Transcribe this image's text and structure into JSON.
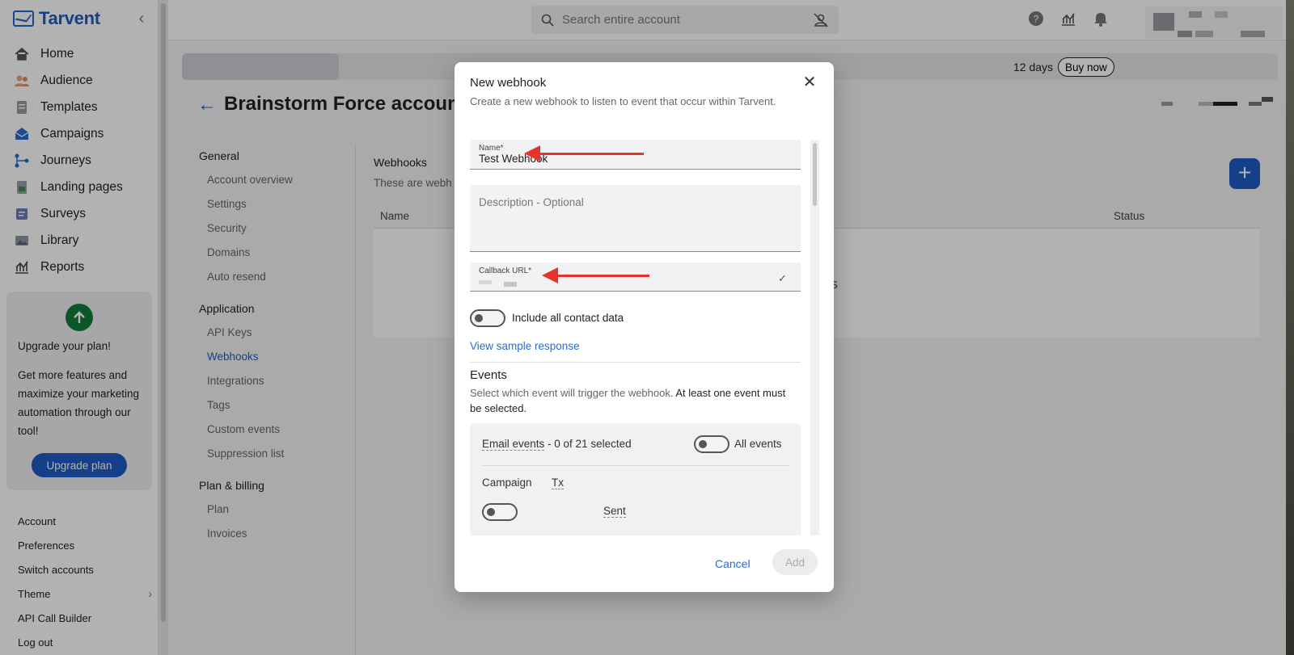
{
  "app": {
    "name": "Tarvent"
  },
  "sidebar": {
    "collapse_icon": "chevron-left-icon",
    "items": [
      {
        "label": "Home",
        "icon": "home-icon"
      },
      {
        "label": "Audience",
        "icon": "audience-icon"
      },
      {
        "label": "Templates",
        "icon": "templates-icon"
      },
      {
        "label": "Campaigns",
        "icon": "campaigns-icon"
      },
      {
        "label": "Journeys",
        "icon": "journeys-icon"
      },
      {
        "label": "Landing pages",
        "icon": "landing-pages-icon"
      },
      {
        "label": "Surveys",
        "icon": "surveys-icon"
      },
      {
        "label": "Library",
        "icon": "library-icon"
      },
      {
        "label": "Reports",
        "icon": "reports-icon"
      }
    ],
    "upgrade": {
      "title": "Upgrade your plan!",
      "text": "Get more features and maximize your marketing automation through our tool!",
      "button": "Upgrade plan"
    },
    "bottom_links": [
      {
        "label": "Account"
      },
      {
        "label": "Preferences"
      },
      {
        "label": "Switch accounts"
      },
      {
        "label": "Theme"
      },
      {
        "label": "API Call Builder"
      },
      {
        "label": "Log out"
      }
    ]
  },
  "topbar": {
    "search_placeholder": "Search entire account"
  },
  "trial": {
    "days_text": "12 days",
    "buy_button": "Buy now"
  },
  "page": {
    "title": "Brainstorm Force account",
    "settings_nav": [
      {
        "group": "General",
        "items": [
          "Account overview",
          "Settings",
          "Security",
          "Domains",
          "Auto resend"
        ]
      },
      {
        "group": "Application",
        "items": [
          "API Keys",
          "Webhooks",
          "Integrations",
          "Tags",
          "Custom events",
          "Suppression list"
        ]
      },
      {
        "group": "Plan & billing",
        "items": [
          "Plan",
          "Invoices"
        ]
      }
    ],
    "active_item": "Webhooks",
    "webhooks": {
      "title": "Webhooks",
      "subtitle": "These are webh",
      "col_name": "Name",
      "col_status": "Status",
      "empty_text": "ooks"
    }
  },
  "modal": {
    "title": "New webhook",
    "subtitle": "Create a new webhook to listen to event that occur within Tarvent.",
    "name_label": "Name*",
    "name_value": "Test Webhook",
    "description_placeholder": "Description - Optional",
    "callback_label": "Callback URL*",
    "include_contact_label": "Include all contact data",
    "sample_link": "View sample response",
    "events_title": "Events",
    "events_desc_1": "Select which event will trigger the webhook. ",
    "events_desc_2": "At least one event must be selected.",
    "email_events_label": "Email events",
    "email_events_count": " - 0 of 21 selected",
    "all_events_label": "All events",
    "campaign_label": "Campaign",
    "tx_label": "Tx",
    "sent_label": "Sent",
    "cancel": "Cancel",
    "add": "Add"
  }
}
